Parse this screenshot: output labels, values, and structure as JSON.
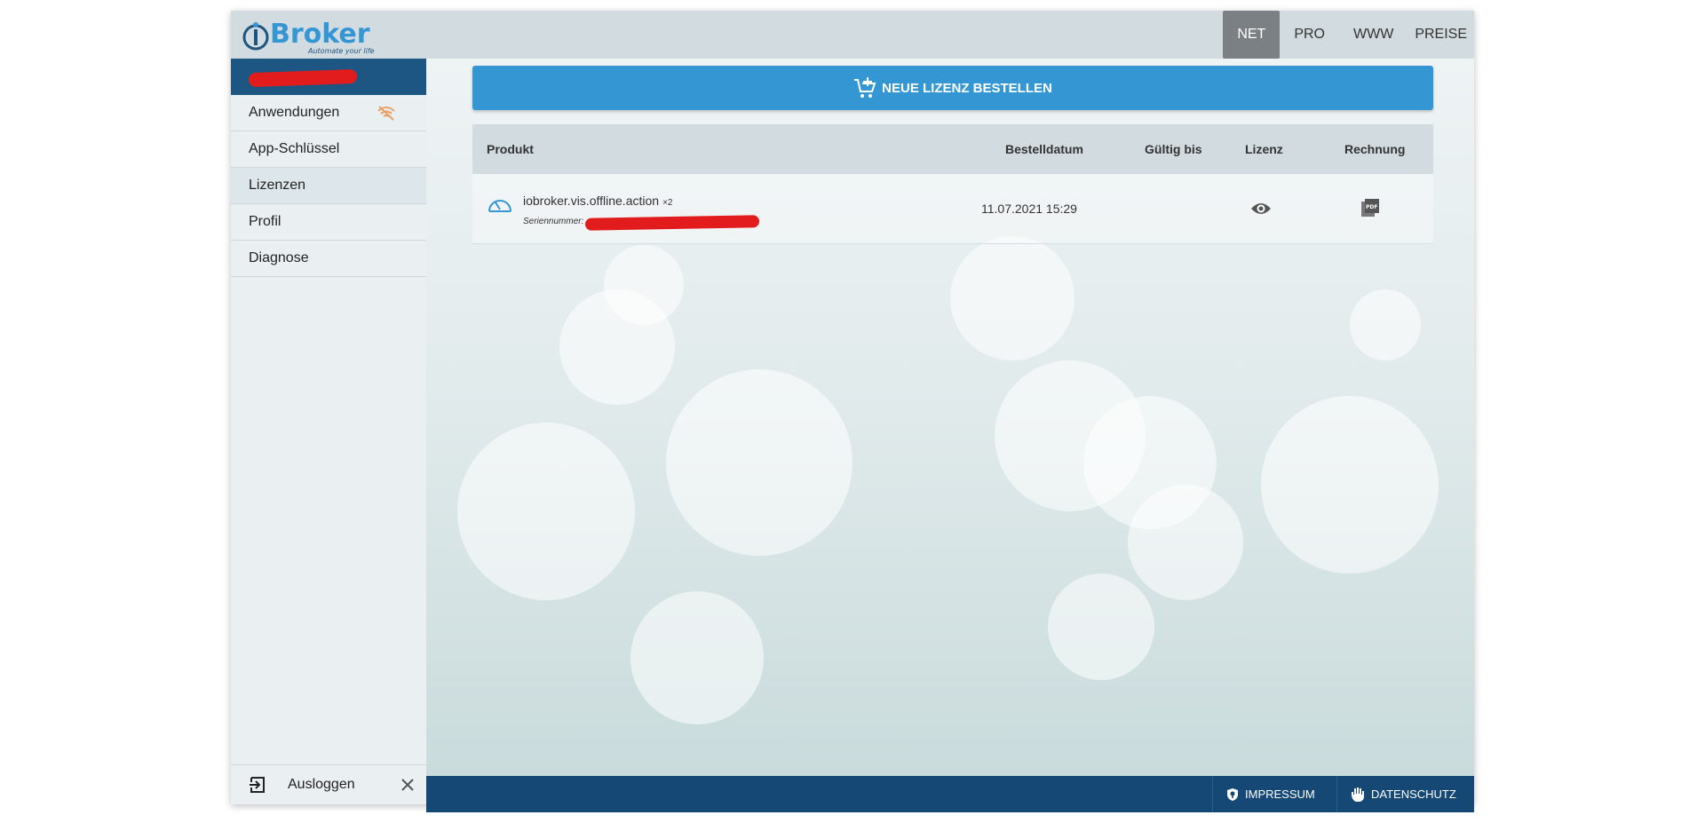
{
  "topnav": {
    "items": [
      {
        "label": "NET",
        "active": true
      },
      {
        "label": "PRO",
        "active": false
      },
      {
        "label": "WWW",
        "active": false
      },
      {
        "label": "PREISE",
        "active": false
      }
    ]
  },
  "logo": {
    "name": "Broker",
    "slogan": "Automate your life"
  },
  "sidebar": {
    "items": [
      {
        "label": "Anwendungen"
      },
      {
        "label": "App-Schlüssel"
      },
      {
        "label": "Lizenzen"
      },
      {
        "label": "Profil"
      },
      {
        "label": "Diagnose"
      }
    ],
    "logout_label": "Ausloggen"
  },
  "main": {
    "order_button_label": "NEUE LIZENZ BESTELLEN",
    "table": {
      "headers": {
        "product": "Produkt",
        "order_date": "Bestelldatum",
        "valid_until": "Gültig bis",
        "license": "Lizenz",
        "invoice": "Rechnung"
      },
      "rows": [
        {
          "product": "iobroker.vis.offline.action",
          "count": "×2",
          "serial_label": "Seriennummer:",
          "order_date": "11.07.2021 15:29",
          "valid_until": ""
        }
      ]
    }
  },
  "footer": {
    "impressum_label": "IMPRESSUM",
    "datenschutz_label": "DATENSCHUTZ"
  },
  "colors": {
    "header_bar": "#d2dbe0",
    "sidebar_header": "#1d5583",
    "primary_button": "#3497d4",
    "footer": "#154874",
    "active_nav": "#7b8084",
    "wifi_off_icon": "#e8a066"
  }
}
